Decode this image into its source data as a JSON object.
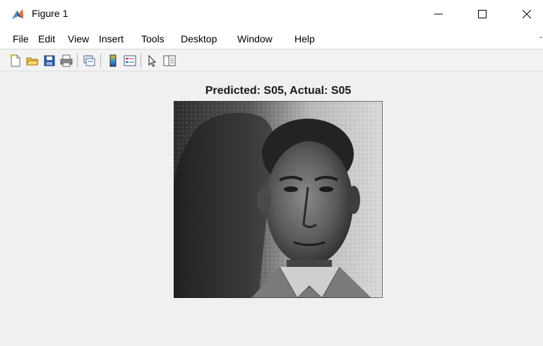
{
  "window": {
    "title": "Figure 1",
    "app_icon": "matlab-icon",
    "controls": [
      "minimize-icon",
      "maximize-icon",
      "close-icon"
    ]
  },
  "menu": {
    "items": [
      "File",
      "Edit",
      "View",
      "Insert",
      "Tools",
      "Desktop",
      "Window",
      "Help"
    ]
  },
  "toolbar": {
    "icons": [
      "new-figure-icon",
      "open-file-icon",
      "save-icon",
      "print-icon",
      "link-plot-icon",
      "insert-colorbar-icon",
      "insert-legend-icon",
      "edit-plot-icon",
      "property-inspector-icon"
    ]
  },
  "figure": {
    "axes_title": "Predicted: S05, Actual: S05",
    "image_alt": "grayscale face photograph of a man against a textured wall",
    "colors": {
      "window_bg": "#f0f0f0",
      "titlebar_bg": "#ffffff",
      "accent_matlab": "#e1712b"
    }
  }
}
